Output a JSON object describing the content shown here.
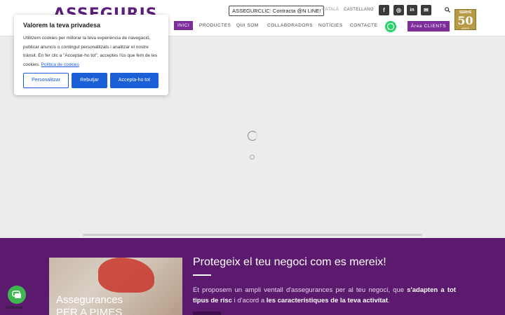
{
  "header": {
    "logo": "ASSEGURIS",
    "cta_online": "ASSEGURCLIC: Contracta @N LINE!",
    "lang_ca": "CATALÀ",
    "lang_es": "CASTELLANO",
    "social": [
      {
        "icon": "facebook-icon",
        "glyph": "f"
      },
      {
        "icon": "instagram-icon",
        "glyph": "◎"
      },
      {
        "icon": "linkedin-icon",
        "glyph": "in"
      },
      {
        "icon": "email-icon",
        "glyph": "✉"
      }
    ],
    "badge": {
      "top": "SERHS",
      "number": "50",
      "bottom": "ANYS"
    }
  },
  "nav": {
    "items": [
      "INICI",
      "PRODUCTES",
      "QUI SOM",
      "COLLABORADORS",
      "NOTÍCIES",
      "CONTACTE"
    ],
    "area_label": "Àrea CLIENTS"
  },
  "section": {
    "card_title_1": "Assegurances",
    "card_title_2": "PER A PIMES",
    "title": "Protegeix el teu negoci com es mereix!",
    "text_1": "Et proposem un ampli ventall d'assegurances per al teu negoci, que ",
    "text_bold_1": "s'adapten a tot tipus de risc",
    "text_2": " i d'acord a ",
    "text_bold_2": "les característiques de la teva activitat",
    "text_3": "."
  },
  "getbutton": {
    "label": "GetButton"
  },
  "cookie": {
    "title": "Valorem la teva privadesa",
    "text": "Utilitzem cookies per millorar la teva experiència de navegació, publicar anuncis o contingut personalitzats i analitzar el nostre trànsit. En fer clic a \"Acceptar-ho tot\", acceptes l'ús que fem de les cookies. ",
    "policy_link": "Política de cookies",
    "btn_customize": "Personalitzar",
    "btn_reject": "Rebutjar",
    "btn_accept": "Accepta-ho tot"
  }
}
